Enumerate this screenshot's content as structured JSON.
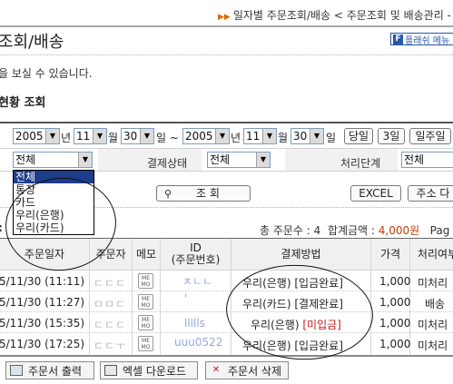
{
  "breadcrumb": {
    "text": "일자별 주문조회/배송 < 주문조회 및 배송관리 -"
  },
  "page_title": "조회/배송",
  "flash_menu": {
    "label": "플래쉬 메뉴"
  },
  "description": "을 보실 수 있습니다.",
  "section_title": "현황 조회",
  "date_range": {
    "start_year": "2005",
    "start_month": "11",
    "start_day": "30",
    "end_year": "2005",
    "end_month": "11",
    "end_day": "30",
    "year_unit": "년",
    "month_unit": "월",
    "day_unit": "일",
    "tilde": "일 ~"
  },
  "quick_buttons": [
    "당일",
    "3일",
    "일주일"
  ],
  "filters": {
    "payment_type_value": "전체",
    "payment_status_label": "결제상태",
    "payment_status_value": "전체",
    "process_stage_label": "처리단계",
    "process_stage_value": "전체"
  },
  "dropdown_options": [
    "전체",
    "통장",
    "카드",
    "우리(은행)",
    "우리(카드)"
  ],
  "search_button": "조 회",
  "excel_button": "EXCEL",
  "address_button": "주소 다",
  "summary": {
    "order_count_label": "총 주문수 : 4",
    "total_label": "합계금액 :",
    "total_value": "4,000원",
    "page_label": "Pag"
  },
  "table": {
    "headers": [
      "주문일자",
      "주문자",
      "메모",
      "ID\n(주문번호)",
      "결제방법",
      "가격",
      "처리여부"
    ],
    "rows": [
      {
        "date": "5/11/30 (11:11)",
        "name": "ㄷㄷㄷ",
        "id": "ㅊㄴㄴ",
        "method": "우리(은행)",
        "status": "[입금완료]",
        "status_color": "#222222",
        "price": "1,000",
        "process": "미처리"
      },
      {
        "date": "5/11/30 (11:27)",
        "name": "ㅁㅁㄷ",
        "id": "'",
        "method": "우리(카드)",
        "status": "[결제완료]",
        "status_color": "#222222",
        "price": "1,000",
        "process": "배송"
      },
      {
        "date": "5/11/30 (15:35)",
        "name": "ㄷㄷㄷ",
        "id": "llllls",
        "method": "우리(은행)",
        "status": "[미입금]",
        "status_color": "#c41a1a",
        "price": "1,000",
        "process": "미처리"
      },
      {
        "date": "5/11/30 (17:25)",
        "name": "ㄷㄷㅜ",
        "id": "uuu0522",
        "method": "우리(은행)",
        "status": "[입금완료]",
        "status_color": "#222222",
        "price": "1,000",
        "process": "미처리"
      }
    ],
    "memo_icon_text": "ME\nMO"
  },
  "bottom_buttons": [
    "주문서 출력",
    "엑셀 다운로드",
    "주문서 삭제"
  ],
  "colors": {
    "accent_orange": "#e06a00",
    "brand_blue": "#2a57a7",
    "selected_blue": "#1c3c8c",
    "amount_red": "#c23c00"
  }
}
